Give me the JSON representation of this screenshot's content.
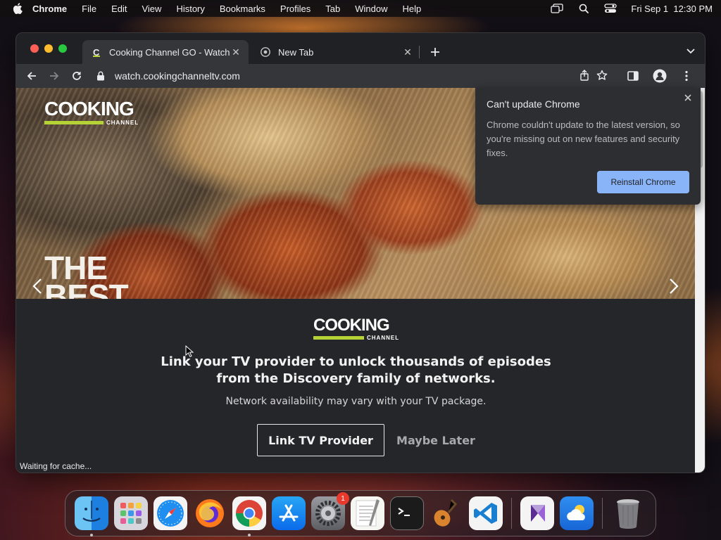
{
  "menubar": {
    "app_name": "Chrome",
    "items": [
      "File",
      "Edit",
      "View",
      "History",
      "Bookmarks",
      "Profiles",
      "Tab",
      "Window",
      "Help"
    ],
    "clock": "Fri Sep 1  12:30 PM"
  },
  "browser": {
    "tabs": [
      {
        "title": "Cooking Channel GO - Watch T",
        "favicon": "cooking-channel-favicon",
        "active": true
      },
      {
        "title": "New Tab",
        "favicon": "chrome-favicon",
        "active": false
      }
    ],
    "url": "watch.cookingchanneltv.com",
    "status_text": "Waiting for cache..."
  },
  "page": {
    "brand": {
      "word": "COOKING",
      "sub": "CHANNEL",
      "accent_color": "#b5d334"
    },
    "hero_text": [
      "THE",
      "BEST"
    ],
    "headline_line1": "Link your TV provider to unlock thousands of episodes",
    "headline_line2": "from the Discovery family of networks.",
    "subline": "Network availability may vary with your TV package.",
    "primary_button": "Link TV Provider",
    "secondary_button": "Maybe Later"
  },
  "popup": {
    "title": "Can't update Chrome",
    "body": "Chrome couldn't update to the latest version, so you're missing out on new features and security fixes.",
    "button": "Reinstall Chrome",
    "button_color": "#8ab4f8"
  },
  "dock": {
    "apps": [
      {
        "name": "Finder",
        "icon": "finder-icon",
        "running": true
      },
      {
        "name": "Launchpad",
        "icon": "launchpad-icon",
        "running": false
      },
      {
        "name": "Safari",
        "icon": "safari-icon",
        "running": false
      },
      {
        "name": "Firefox",
        "icon": "firefox-icon",
        "running": false
      },
      {
        "name": "Chrome",
        "icon": "chrome-icon",
        "running": true
      },
      {
        "name": "App Store",
        "icon": "app-store-icon",
        "running": false
      },
      {
        "name": "System Settings",
        "icon": "settings-icon",
        "running": false,
        "badge": "1"
      },
      {
        "name": "TextEdit",
        "icon": "textedit-icon",
        "running": false
      },
      {
        "name": "Terminal",
        "icon": "terminal-icon",
        "running": false
      },
      {
        "name": "Instruments",
        "icon": "guitar-icon",
        "running": false
      },
      {
        "name": "VS Code",
        "icon": "vscode-icon",
        "running": false
      },
      {
        "name": "Visual Studio",
        "icon": "visual-studio-icon",
        "running": false
      },
      {
        "name": "Weather",
        "icon": "weather-icon",
        "running": false
      },
      {
        "name": "Trash",
        "icon": "trash-icon",
        "running": false
      }
    ]
  }
}
